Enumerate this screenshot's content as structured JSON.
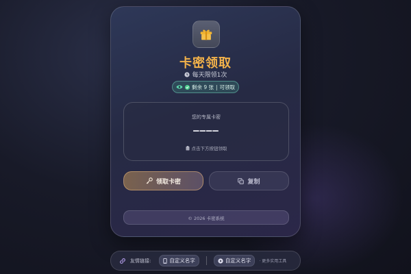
{
  "card": {
    "title": "卡密领取",
    "subtitle": "每天限领1次",
    "status": {
      "remaining": "剩余 9 张",
      "state": "可领取"
    },
    "code_box": {
      "label": "您的专属卡密",
      "value": "————",
      "hint": "点击下方按钮领取"
    },
    "buttons": {
      "claim": "领取卡密",
      "copy": "复制"
    },
    "footer": "© 2026 卡密系统"
  },
  "links_bar": {
    "label": "友情链接:",
    "links": [
      {
        "text": "自定义名字",
        "icon": "phone-icon"
      },
      {
        "text": "自定义名字",
        "icon": "play-icon"
      }
    ],
    "more": "更多实用工具"
  },
  "colors": {
    "accent": "#f3b24a",
    "status_green": "#4fd18f"
  }
}
